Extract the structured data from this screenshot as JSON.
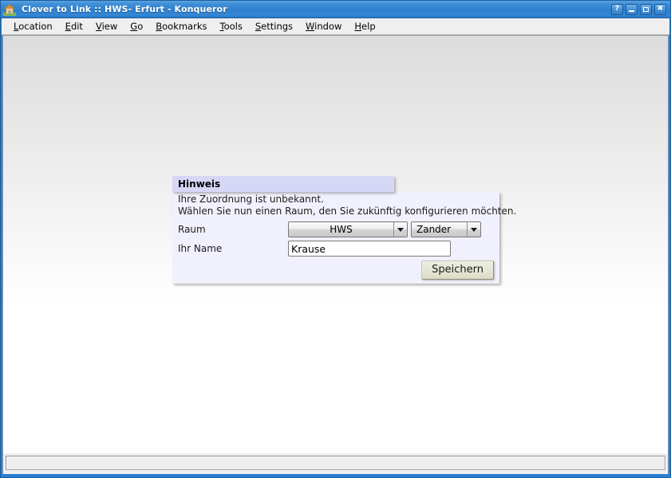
{
  "window": {
    "title": "Clever to Link :: HWS- Erfurt - Konqueror",
    "icon": "home-icon",
    "buttons": {
      "help": "?",
      "minimize": "_",
      "maximize": "□",
      "close": "✖"
    }
  },
  "menubar": {
    "items": [
      {
        "label": "Location",
        "accel": "L"
      },
      {
        "label": "Edit",
        "accel": "E"
      },
      {
        "label": "View",
        "accel": "V"
      },
      {
        "label": "Go",
        "accel": "G"
      },
      {
        "label": "Bookmarks",
        "accel": "B"
      },
      {
        "label": "Tools",
        "accel": "T"
      },
      {
        "label": "Settings",
        "accel": "S"
      },
      {
        "label": "Window",
        "accel": "W"
      },
      {
        "label": "Help",
        "accel": "H"
      }
    ]
  },
  "dialog": {
    "header": "Hinweis",
    "message_line1": "Ihre Zuordnung ist unbekannt.",
    "message_line2": "Wählen Sie nun einen Raum, den Sie zukünftig konfigurieren möchten.",
    "fields": {
      "raum": {
        "label": "Raum",
        "room_select_value": "HWS",
        "person_select_value": "Zander"
      },
      "name": {
        "label": "Ihr Name",
        "value": "Krause",
        "placeholder": ""
      }
    },
    "save_button": "Speichern"
  },
  "statusbar": {
    "text": ""
  },
  "colors": {
    "titlebar_blue": "#2f7fce",
    "dialog_header": "#d6d6f7",
    "dialog_body": "#f1f1fd",
    "button_face": "#e6e6d6"
  }
}
